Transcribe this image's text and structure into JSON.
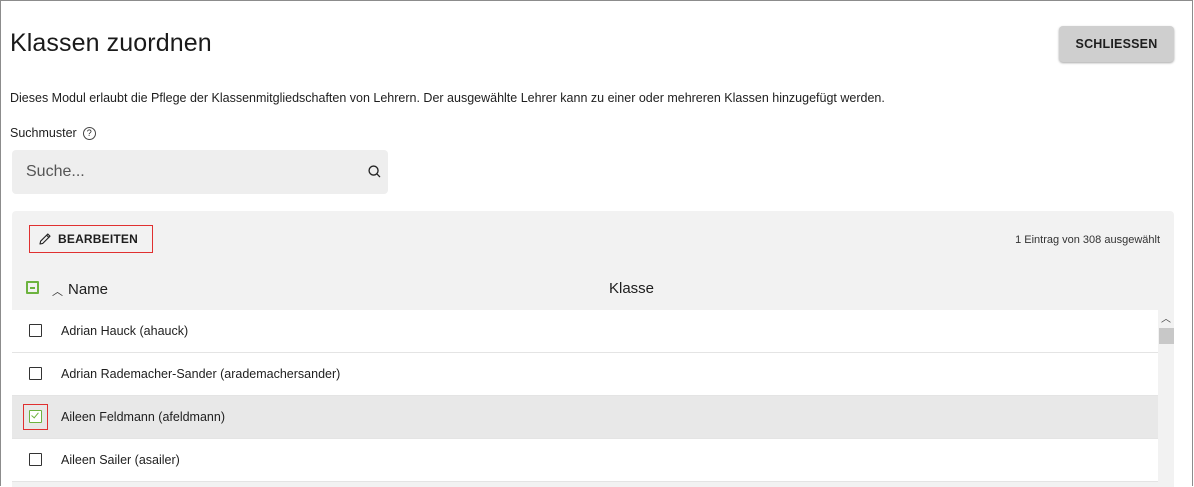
{
  "page": {
    "title": "Klassen zuordnen",
    "close_label": "SCHLIESSEN",
    "description": "Dieses Modul erlaubt die Pflege der Klassenmitgliedschaften von Lehrern. Der ausgewählte Lehrer kann zu einer oder mehreren Klassen hinzugefügt werden."
  },
  "search": {
    "label": "Suchmuster",
    "placeholder": "Suche...",
    "help_icon": "help-circle-icon",
    "icon": "search-icon"
  },
  "grid": {
    "edit_label": "BEARBEITEN",
    "edit_icon": "pencil-icon",
    "status": "1 Eintrag von 308 ausgewählt",
    "columns": {
      "name": "Name",
      "klasse": "Klasse"
    },
    "rows": [
      {
        "name": "Adrian Hauck (ahauck)",
        "checked": false
      },
      {
        "name": "Adrian Rademacher-Sander (arademachersander)",
        "checked": false
      },
      {
        "name": "Aileen Feldmann (afeldmann)",
        "checked": true
      },
      {
        "name": "Aileen Sailer (asailer)",
        "checked": false
      }
    ]
  },
  "colors": {
    "accent_green": "#6db33f",
    "highlight_red": "#e03030",
    "button_gray": "#cfcfcf"
  }
}
